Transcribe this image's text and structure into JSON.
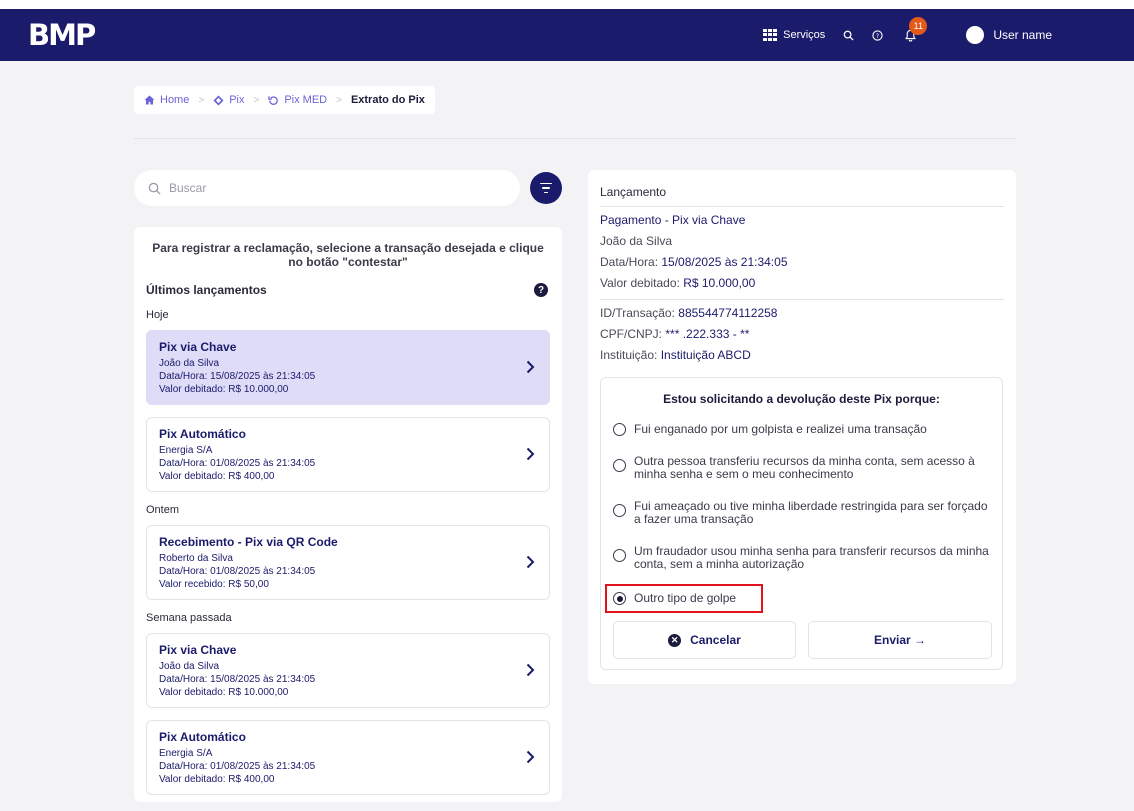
{
  "header": {
    "logo": "BMP",
    "services_label": "Serviços",
    "notification_count": "11",
    "user_name": "User name"
  },
  "breadcrumb": {
    "home": "Home",
    "pix": "Pix",
    "pix_med": "Pix MED",
    "current": "Extrato do Pix"
  },
  "search": {
    "placeholder": "Buscar"
  },
  "list": {
    "instruction": "Para registrar a reclamação, selecione a transação desejada e clique no botão \"contestar\"",
    "heading": "Últimos lançamentos",
    "groups": [
      {
        "label": "Hoje",
        "items": [
          {
            "title": "Pix via Chave",
            "name": "João da Silva",
            "datetime": "Data/Hora: 15/08/2025 às 21:34:05",
            "value": "Valor debitado: R$ 10.000,00"
          },
          {
            "title": "Pix Automático",
            "name": "Energia S/A",
            "datetime": "Data/Hora: 01/08/2025 às 21:34:05",
            "value": "Valor debitado: R$ 400,00"
          }
        ]
      },
      {
        "label": "Ontem",
        "items": [
          {
            "title": "Recebimento - Pix via QR Code",
            "name": "Roberto da Silva",
            "datetime": "Data/Hora: 01/08/2025 às 21:34:05",
            "value": "Valor recebido: R$ 50,00"
          }
        ]
      },
      {
        "label": "Semana passada",
        "items": [
          {
            "title": "Pix via Chave",
            "name": "João da Silva",
            "datetime": "Data/Hora: 15/08/2025 às 21:34:05",
            "value": "Valor debitado: R$ 10.000,00"
          },
          {
            "title": "Pix Automático",
            "name": "Energia S/A",
            "datetime": "Data/Hora: 01/08/2025 às 21:34:05",
            "value": "Valor debitado: R$ 400,00"
          }
        ]
      }
    ]
  },
  "detail": {
    "heading": "Lançamento",
    "type": "Pagamento - Pix via Chave",
    "name": "João da Silva",
    "datetime_label": "Data/Hora:",
    "datetime_value": "15/08/2025 às 21:34:05",
    "value_label": "Valor debitado:",
    "value_value": "R$ 10.000,00",
    "id_label": "ID/Transação:",
    "id_value": "885544774112258",
    "cpf_label": "CPF/CNPJ:",
    "cpf_value": "*** .222.333 - **",
    "inst_label": "Instituição:",
    "inst_value": "Instituição ABCD"
  },
  "reasons": {
    "title": "Estou solicitando a devolução deste Pix porque:",
    "options": [
      "Fui enganado por um golpista e realizei uma transação",
      "Outra pessoa transferiu recursos da minha conta, sem acesso à minha senha e sem o meu conhecimento",
      "Fui ameaçado ou tive minha liberdade restringida para ser forçado a fazer uma transação",
      "Um fraudador usou minha senha para transferir recursos da minha conta, sem a minha autorização",
      "Outro tipo de golpe"
    ],
    "cancel_label": "Cancelar",
    "send_label": "Enviar →"
  }
}
